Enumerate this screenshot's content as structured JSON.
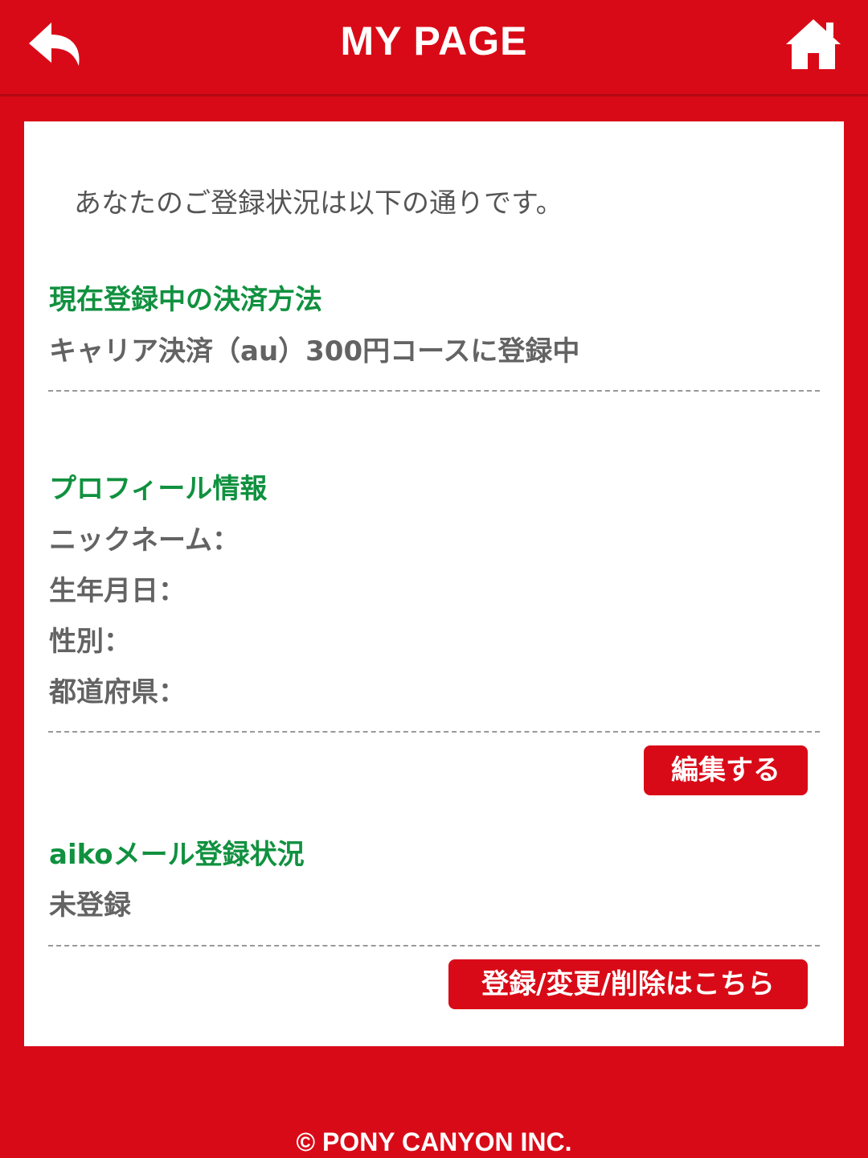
{
  "header": {
    "title": "MY PAGE",
    "back_icon": "back-arrow-icon",
    "home_icon": "home-icon"
  },
  "content": {
    "intro": "あなたのご登録状況は以下の通りです。",
    "payment": {
      "title": "現在登録中の決済方法",
      "value": "キャリア決済（au）300円コースに登録中"
    },
    "profile": {
      "title": "プロフィール情報",
      "fields": [
        {
          "label": "ニックネーム：",
          "value": ""
        },
        {
          "label": "生年月日：",
          "value": ""
        },
        {
          "label": "性別：",
          "value": ""
        },
        {
          "label": "都道府県：",
          "value": ""
        }
      ],
      "edit_label": "編集する"
    },
    "mail": {
      "title": "aikoメール登録状況",
      "value": "未登録",
      "button_label": "登録/変更/削除はこちら"
    }
  },
  "footer": {
    "copyright": "© PONY CANYON INC."
  },
  "colors": {
    "brand_red": "#d90a17",
    "section_green": "#10913f",
    "text_gray": "#636363"
  }
}
